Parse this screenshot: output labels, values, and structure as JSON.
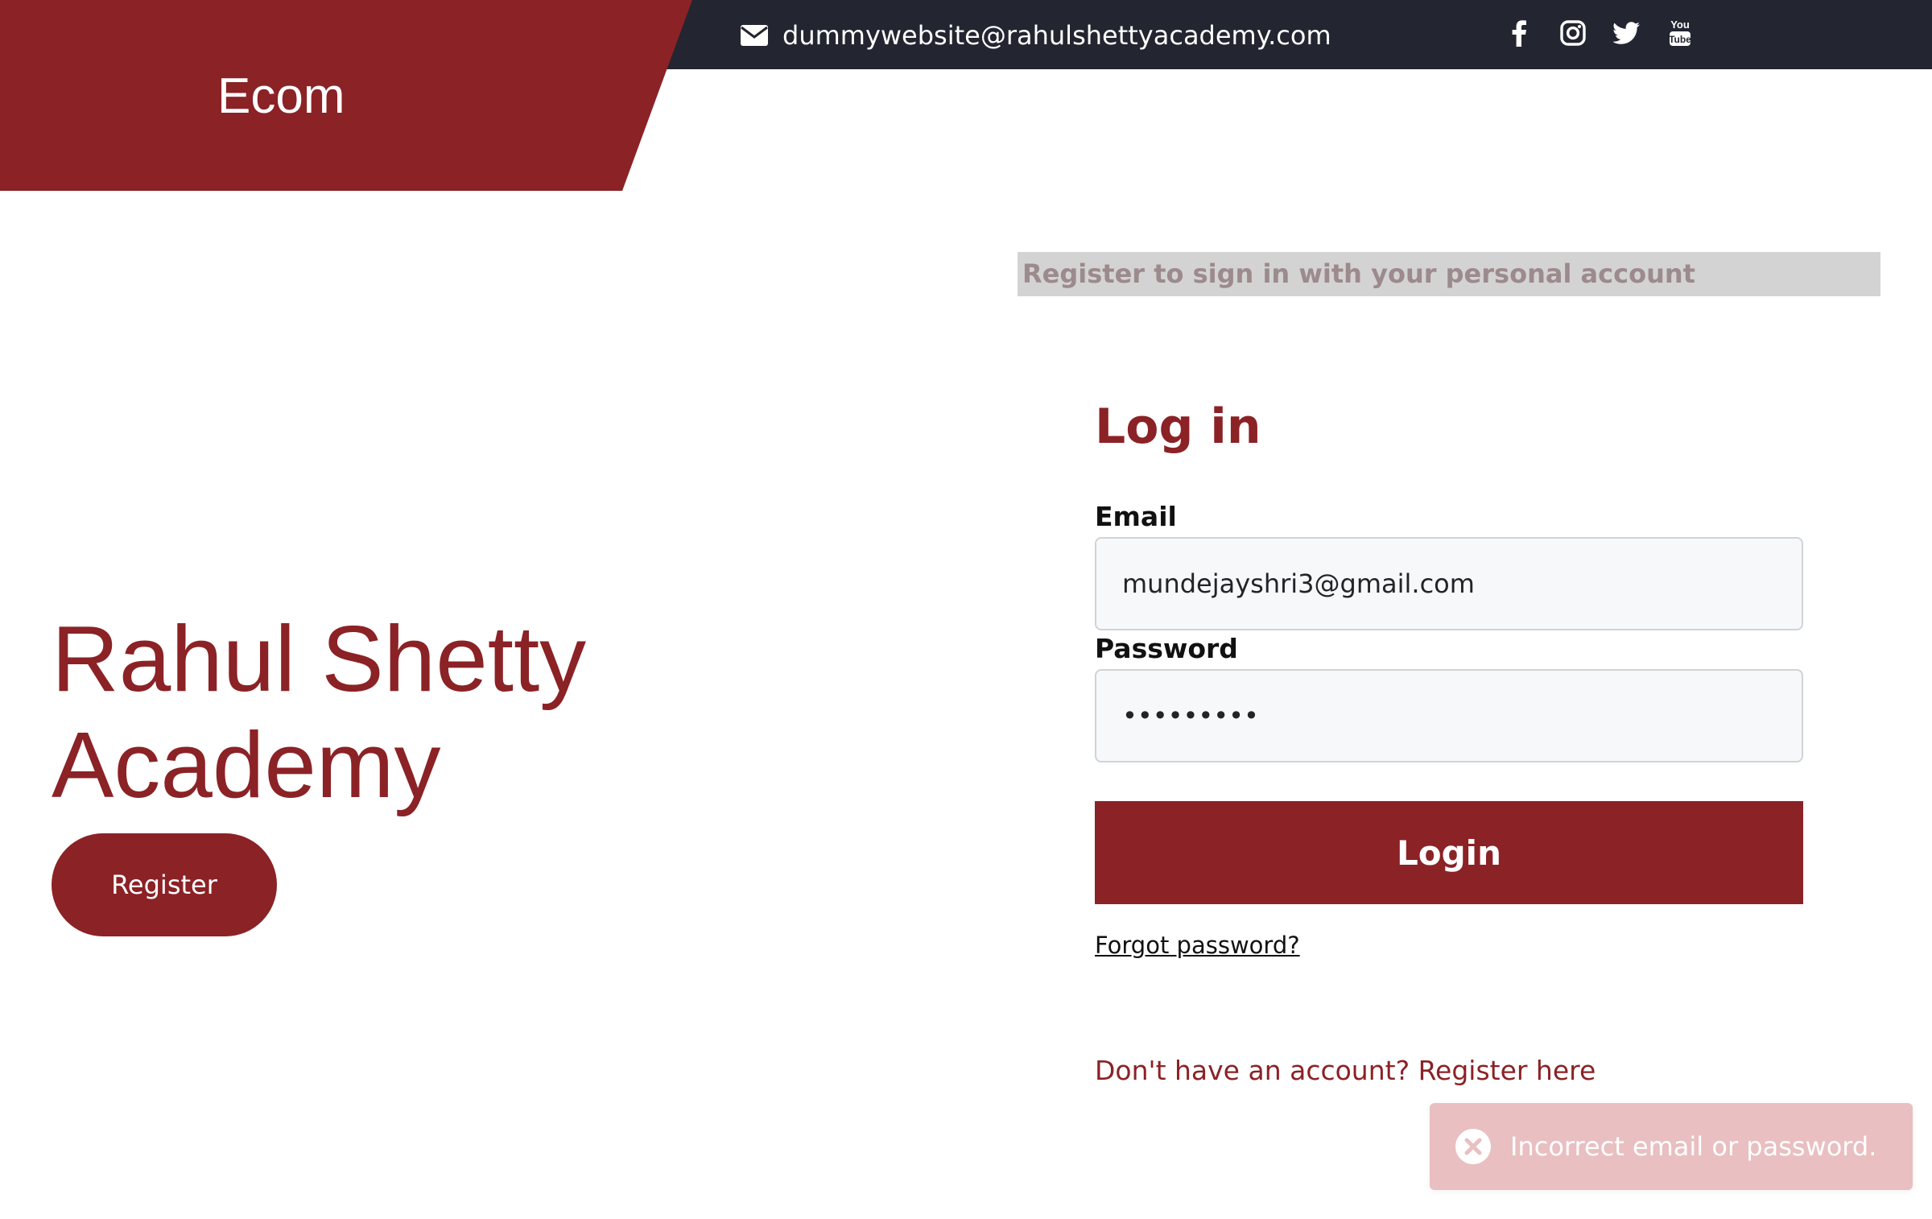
{
  "header": {
    "brand": "Ecom",
    "contact_email": "dummywebsite@rahulshettyacademy.com",
    "social_icons": [
      "facebook-icon",
      "instagram-icon",
      "twitter-icon",
      "youtube-icon"
    ]
  },
  "hero": {
    "title_line1": "Rahul Shetty",
    "title_line2": "Academy",
    "register_label": "Register"
  },
  "login": {
    "notice": "Register to sign in with your personal account",
    "heading": "Log in",
    "email_label": "Email",
    "email_value": "mundejayshri3@gmail.com",
    "password_label": "Password",
    "password_value": "•••••••••",
    "submit_label": "Login",
    "forgot_label": "Forgot password?",
    "register_prompt": "Don't have an account? Register here"
  },
  "toast": {
    "message": "Incorrect email or password."
  },
  "colors": {
    "brand": "#8b2226",
    "topbar": "#232530",
    "toast_bg": "#e9bfc1"
  }
}
